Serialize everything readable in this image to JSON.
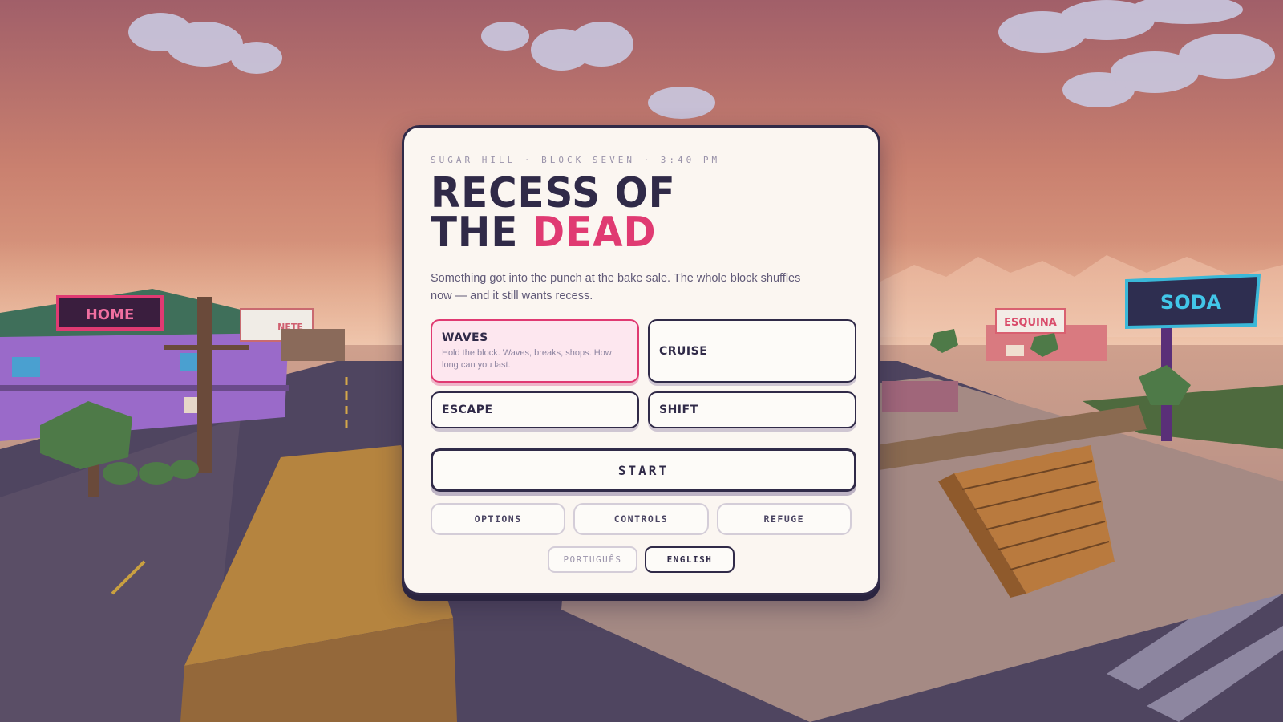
{
  "colors": {
    "sky_top": "#a5606a",
    "sky_bottom": "#e0a07e",
    "panel_bg": "#fbf6f1",
    "ink": "#302a48",
    "accent": "#e03a72",
    "selected_bg": "#fde7ef"
  },
  "scene": {
    "signs": {
      "home": "HOME",
      "partial": "NETE",
      "esquina": "ESQUINA",
      "soda": "SODA"
    }
  },
  "menu": {
    "eyebrow": "SUGAR HILL · BLOCK SEVEN · 3:40 PM",
    "title_line1": "RECESS OF",
    "title_line2_plain": "THE ",
    "title_line2_accent": "DEAD",
    "description": "Something got into the punch at the bake sale. The whole block shuffles now — and it still wants recess.",
    "modes": [
      {
        "name": "WAVES",
        "description": "Hold the block. Waves, breaks, shops. How long can you last.",
        "selected": true
      },
      {
        "name": "CRUISE",
        "description": "",
        "selected": false
      },
      {
        "name": "ESCAPE",
        "description": "",
        "selected": false
      },
      {
        "name": "SHIFT",
        "description": "",
        "selected": false
      }
    ],
    "start_label": "START",
    "secondary": [
      "OPTIONS",
      "CONTROLS",
      "REFUGE"
    ],
    "languages": [
      {
        "label": "PORTUGUÊS",
        "active": false
      },
      {
        "label": "ENGLISH",
        "active": true
      }
    ]
  }
}
